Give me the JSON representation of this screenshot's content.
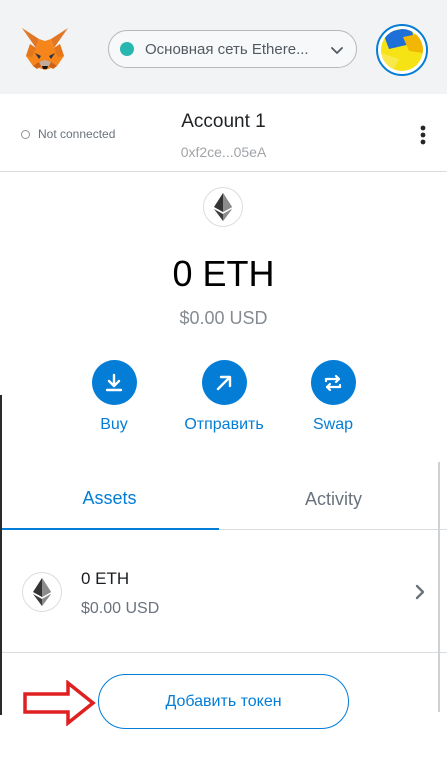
{
  "header": {
    "network_name": "Основная сеть Ethere...",
    "network_color": "#29b6af"
  },
  "account": {
    "connection_status": "Not connected",
    "name": "Account 1",
    "address": "0xf2ce...05eA"
  },
  "balance": {
    "amount": "0 ETH",
    "usd": "$0.00 USD"
  },
  "actions": [
    {
      "label": "Buy",
      "icon": "download-icon"
    },
    {
      "label": "Отправить",
      "icon": "arrow-up-right-icon"
    },
    {
      "label": "Swap",
      "icon": "swap-icon"
    }
  ],
  "tabs": [
    {
      "label": "Assets",
      "active": true
    },
    {
      "label": "Activity",
      "active": false
    }
  ],
  "assets": [
    {
      "amount": "0 ETH",
      "usd": "$0.00 USD",
      "icon": "ethereum-icon"
    }
  ],
  "add_token_label": "Добавить токен",
  "colors": {
    "accent": "#037dd6",
    "annotation_arrow": "#e02020"
  }
}
